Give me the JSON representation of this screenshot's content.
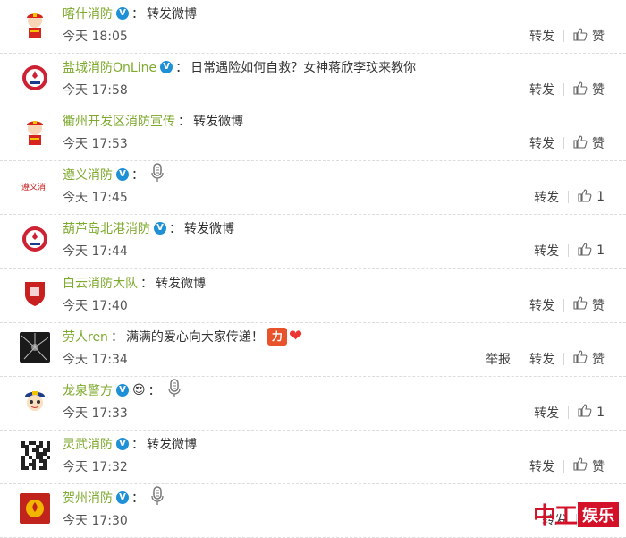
{
  "rows": [
    {
      "name": "喀什消防",
      "verified": true,
      "content": "转发微博",
      "time": "今天 18:05",
      "report": "",
      "repost": "转发",
      "like": "赞",
      "mic": false,
      "avatar": "cartoon-firefighter"
    },
    {
      "name": "盐城消防OnLine",
      "verified": true,
      "content": "日常遇险如何自救？女神蒋欣李玟来教你",
      "time": "今天 17:58",
      "report": "",
      "repost": "转发",
      "like": "赞",
      "mic": false,
      "avatar": "fire-emblem"
    },
    {
      "name": "衢州开发区消防宣传",
      "verified": false,
      "content": "转发微博",
      "time": "今天 17:53",
      "report": "",
      "repost": "转发",
      "like": "赞",
      "mic": false,
      "avatar": "cartoon-firefighter"
    },
    {
      "name": "遵义消防",
      "verified": true,
      "content": "",
      "time": "今天 17:45",
      "report": "",
      "repost": "转发",
      "like": "1",
      "mic": true,
      "avatar": "red-calligraphy"
    },
    {
      "name": "葫芦岛北港消防",
      "verified": true,
      "content": "转发微博",
      "time": "今天 17:44",
      "report": "",
      "repost": "转发",
      "like": "1",
      "mic": false,
      "avatar": "fire-emblem"
    },
    {
      "name": "白云消防大队",
      "verified": false,
      "content": "转发微博",
      "time": "今天 17:40",
      "report": "",
      "repost": "转发",
      "like": "赞",
      "mic": false,
      "avatar": "red-shield"
    },
    {
      "name": "劳人ren",
      "verified": false,
      "content": "满满的爱心向大家传递！",
      "time": "今天 17:34",
      "report": "举报",
      "repost": "转发",
      "like": "赞",
      "mic": false,
      "avatar": "dark-burst",
      "emoji": "力"
    },
    {
      "name": "龙泉警方",
      "verified": true,
      "content": "",
      "time": "今天 17:33",
      "report": "",
      "repost": "转发",
      "like": "1",
      "mic": true,
      "avatar": "police-cartoon"
    },
    {
      "name": "灵武消防",
      "verified": true,
      "content": "转发微博",
      "time": "今天 17:32",
      "report": "",
      "repost": "转发",
      "like": "赞",
      "mic": false,
      "avatar": "qr-code"
    },
    {
      "name": "贺州消防",
      "verified": true,
      "content": "",
      "time": "今天 17:30",
      "report": "",
      "repost": "转发",
      "like": "",
      "mic": true,
      "avatar": "fire-badge"
    }
  ],
  "colon": "：",
  "brand": {
    "red_text": "中工",
    "box_text": "娱乐"
  }
}
